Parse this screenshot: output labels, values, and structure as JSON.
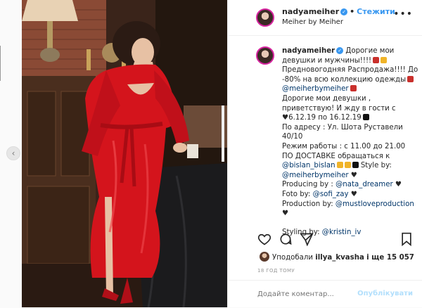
{
  "post": {
    "username": "nadyameiher",
    "follow_label": "Стежити",
    "location": "Meiher by Meiher",
    "caption": {
      "line1_text": "Дорогие мои девушки и мужчины!!!!",
      "line2": "Предновогодняя Распродажа!!!! До -80% на всю коллекцию одежды",
      "mention_meiher": "@meiherbymeiher",
      "line3": "Дорогие мои девушки , приветствую! И жду в гости с",
      "dates": "♥6.12.19 по 16.12.19",
      "address": "По адресу : Ул. Шота Руставели 40/10",
      "hours": "Режим работы : с 11.00 до 21.00",
      "delivery": "ПО ДОСТАВКЕ обращаться к",
      "mention_bislan": "@bislan_bislan",
      "style_label": "Style by:",
      "style_mention": "@meiherbymeiher",
      "producing_label": "Producing by :",
      "producing_mention": "@nata_dreamer",
      "foto_label": "Foto by:",
      "foto_mention": "@sofi_zay",
      "production_label": "Production by:",
      "production_mention": "@mustloveproduction",
      "styling_label": "Styling by:",
      "styling_mention": "@kristin_iv"
    },
    "likes_prefix": "Уподобали",
    "likes_user": "illya_kvasha",
    "likes_suffix": "і ще 15 057",
    "timestamp": "18 ГОД ТОМУ",
    "comment_placeholder": "Додайте коментар...",
    "publish_label": "Опублікувати"
  },
  "colors": {
    "link": "#003569",
    "follow": "#3897f0",
    "dress": "#d4141c"
  },
  "icons": [
    "carousel-prev-icon",
    "more-options-icon",
    "verified-icon",
    "heart-icon",
    "comment-icon",
    "share-icon",
    "bookmark-icon"
  ]
}
